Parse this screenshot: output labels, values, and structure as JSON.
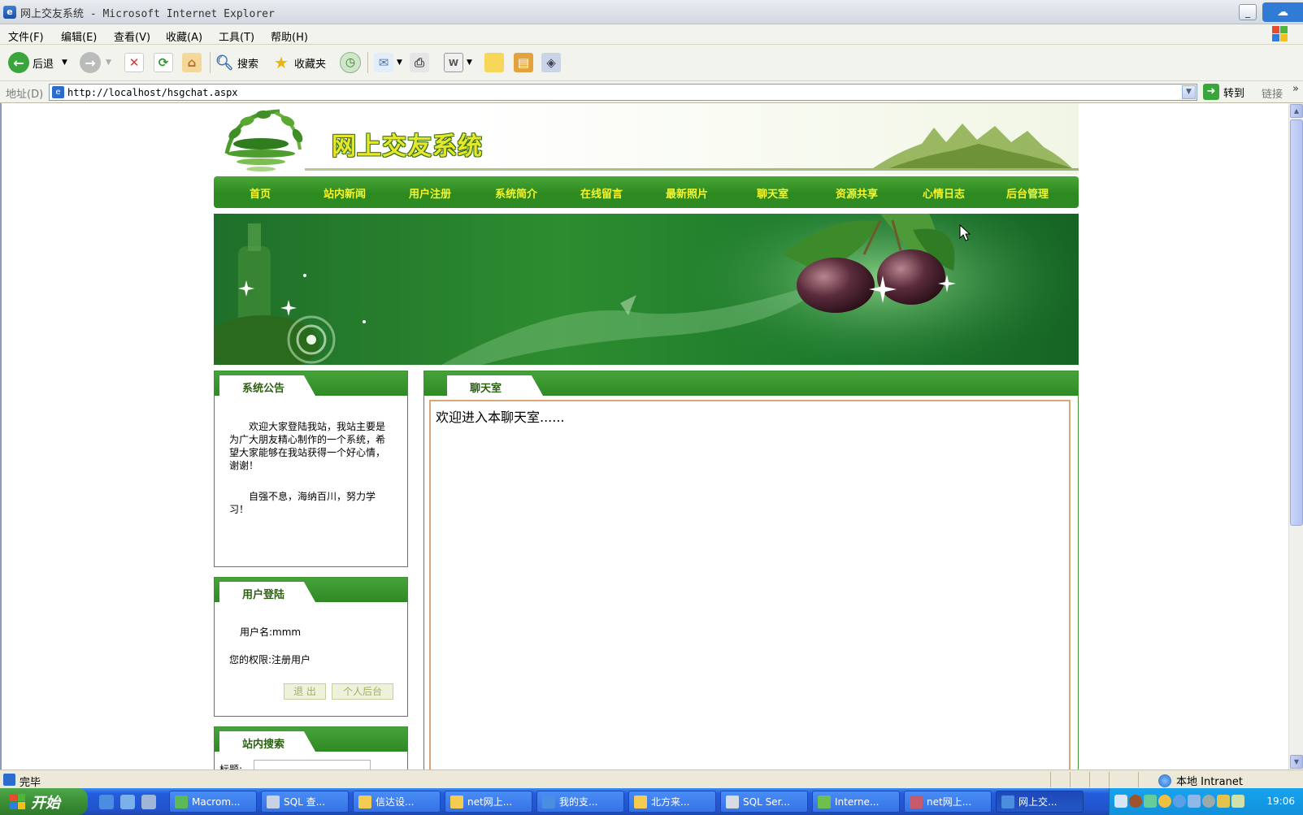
{
  "window": {
    "title": "网上交友系统 - Microsoft Internet Explorer"
  },
  "menu": [
    "文件(F)",
    "编辑(E)",
    "查看(V)",
    "收藏(A)",
    "工具(T)",
    "帮助(H)"
  ],
  "toolbar": {
    "back": "后退",
    "search": "搜索",
    "favorites": "收藏夹"
  },
  "address": {
    "label": "地址(D)",
    "url": "http://localhost/hsgchat.aspx",
    "go": "转到",
    "links": "链接",
    "more": "»"
  },
  "site": {
    "title": "网上交友系统",
    "nav": [
      "首页",
      "站内新闻",
      "用户注册",
      "系统简介",
      "在线留言",
      "最新照片",
      "聊天室",
      "资源共享",
      "心情日志",
      "后台管理"
    ],
    "notice": {
      "heading": "系统公告",
      "paragraph1": "欢迎大家登陆我站，我站主要是为广大朋友精心制作的一个系统，希望大家能够在我站获得一个好心情，谢谢！",
      "paragraph2": "自强不息，海纳百川，努力学习！"
    },
    "login": {
      "heading": "用户登陆",
      "username": "用户名:mmm",
      "permission": "您的权限:注册用户",
      "logout": "退 出",
      "personal": "个人后台"
    },
    "search": {
      "heading": "站内搜索",
      "label": "标题:"
    },
    "chat": {
      "heading": "聊天室",
      "welcome": "欢迎进入本聊天室......"
    }
  },
  "status": {
    "text": "完毕",
    "zone": "本地 Intranet"
  },
  "taskbar": {
    "start": "开始",
    "tasks": [
      "Macrom...",
      "SQL 查...",
      "信达设...",
      "net网上...",
      "我的支...",
      "北方来...",
      "SQL Ser...",
      "Interne...",
      "net网上...",
      "网上交..."
    ],
    "clock": "19:06"
  },
  "colors": {
    "nav_green": "#2d8a21",
    "nav_text": "#f7f52b",
    "title_yellow": "#e5e82a",
    "chat_border": "#d9a777"
  }
}
